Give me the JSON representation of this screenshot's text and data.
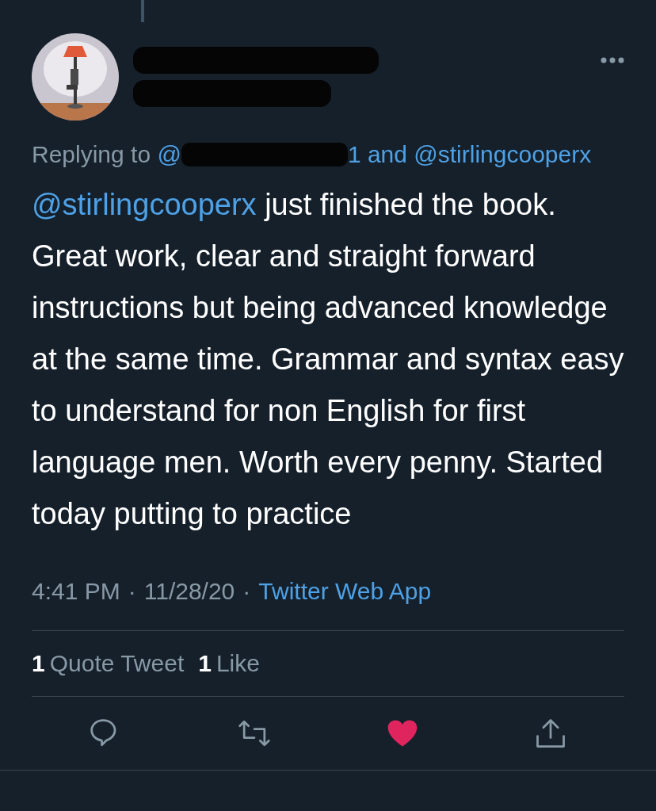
{
  "header": {
    "redacted_name": true,
    "redacted_handle": true
  },
  "reply_context": {
    "prefix": "Replying to",
    "mention_start": "@",
    "mention_end": "1 and @stirlingcooperx"
  },
  "tweet": {
    "mention": "@stirlingcooperx",
    "text": "just finished the book. Great work, clear and straight forward instructions but being advanced knowledge at the same time. Grammar and syntax easy to understand for non English for first language men. Worth every penny. Started today putting to practice"
  },
  "meta": {
    "time": "4:41 PM",
    "separator": "·",
    "date": "11/28/20",
    "source": "Twitter Web App"
  },
  "stats": [
    {
      "count": "1",
      "label": "Quote Tweet"
    },
    {
      "count": "1",
      "label": "Like"
    }
  ],
  "actions": [
    {
      "kind": "reply"
    },
    {
      "kind": "retweet"
    },
    {
      "kind": "like",
      "liked": true
    },
    {
      "kind": "share"
    }
  ]
}
